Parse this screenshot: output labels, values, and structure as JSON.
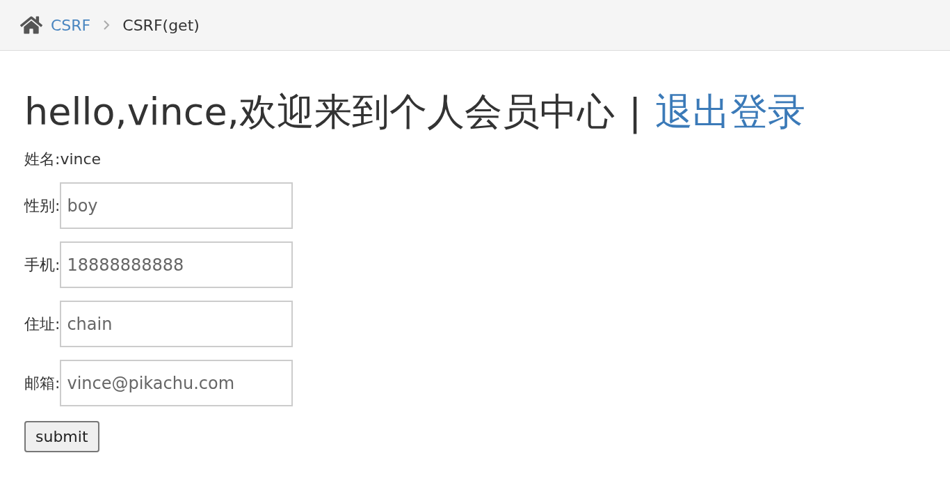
{
  "breadcrumb": [
    {
      "label": "CSRF",
      "kind": "link"
    },
    {
      "label": "CSRF(get)",
      "kind": "current"
    }
  ],
  "title": {
    "greeting": "hello,vince,欢迎来到个人会员中心",
    "separator": "|",
    "logout": "退出登录"
  },
  "name_line": "姓名:vince",
  "fields": [
    {
      "label": "性别:",
      "value": "boy"
    },
    {
      "label": "手机:",
      "value": "18888888888"
    },
    {
      "label": "住址:",
      "value": "chain"
    },
    {
      "label": "邮箱:",
      "value": "vince@pikachu.com"
    }
  ],
  "submit": "submit"
}
